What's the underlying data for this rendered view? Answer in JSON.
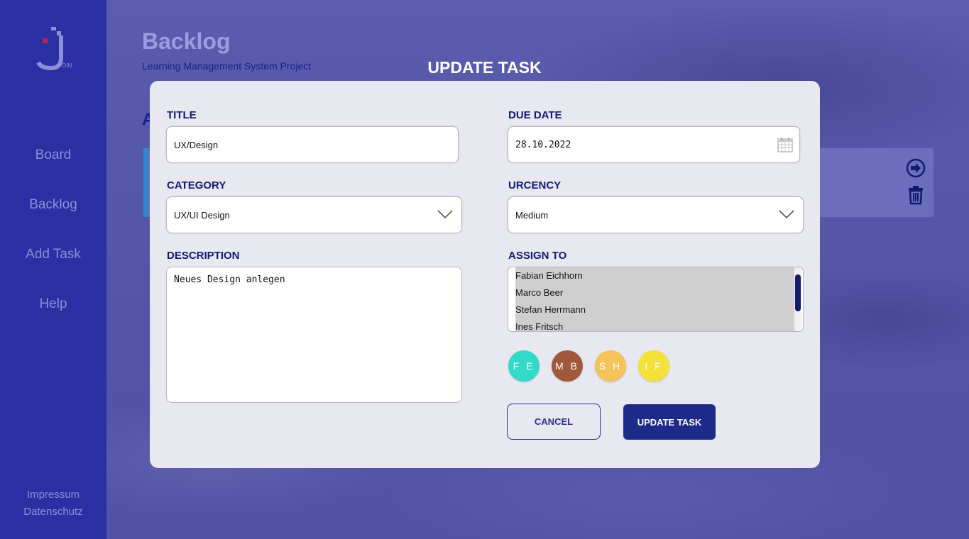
{
  "sidebar": {
    "nav": [
      {
        "label": "Board"
      },
      {
        "label": "Backlog"
      },
      {
        "label": "Add Task"
      },
      {
        "label": "Help"
      }
    ],
    "footer": {
      "impressum": "Impressum",
      "datenschutz": "Datenschutz"
    }
  },
  "page": {
    "title": "Backlog",
    "subtitle": "Learning Management System Project",
    "section_initial": "A"
  },
  "modal": {
    "heading": "UPDATE TASK",
    "title_label": "TITLE",
    "title_value": "UX/Design",
    "due_label": "DUE DATE",
    "due_value": "28.10.2022",
    "category_label": "CATEGORY",
    "category_value": "UX/UI Design",
    "urgency_label": "URCENCY",
    "urgency_value": "Medium",
    "description_label": "DESCRIPTION",
    "description_value": "Neues Design anlegen",
    "assign_label": "ASSIGN TO",
    "assignees": [
      "Fabian Eichhorn",
      "Marco Beer",
      "Stefan Herrmann",
      "Ines Fritsch"
    ],
    "avatars": [
      {
        "initials": "F E",
        "color": "#33d9c9"
      },
      {
        "initials": "M B",
        "color": "#a0583a"
      },
      {
        "initials": "S H",
        "color": "#f5c35a"
      },
      {
        "initials": "I F",
        "color": "#f4e13a"
      }
    ],
    "cancel_label": "CANCEL",
    "update_label": "UPDATE TASK"
  },
  "colors": {
    "accent": "#1c2a8a",
    "sidebar": "#2a2fa3",
    "label": "#141875"
  }
}
